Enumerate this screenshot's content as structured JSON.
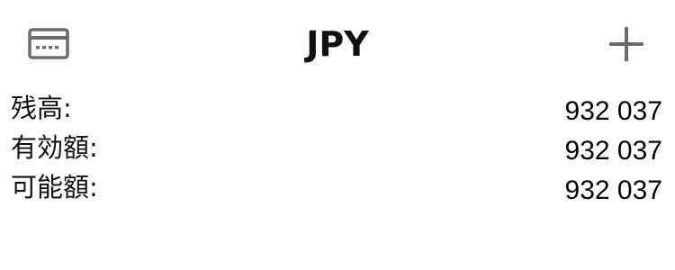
{
  "header": {
    "title": "JPY",
    "left_icon": "credit-card-icon",
    "right_icon": "plus-icon"
  },
  "balances": [
    {
      "label": "残高:",
      "value": "932 037"
    },
    {
      "label": "有効額:",
      "value": "932 037"
    },
    {
      "label": "可能額:",
      "value": "932 037"
    }
  ],
  "colors": {
    "icon": "#6b6b6b",
    "text": "#111111",
    "background": "#ffffff"
  }
}
